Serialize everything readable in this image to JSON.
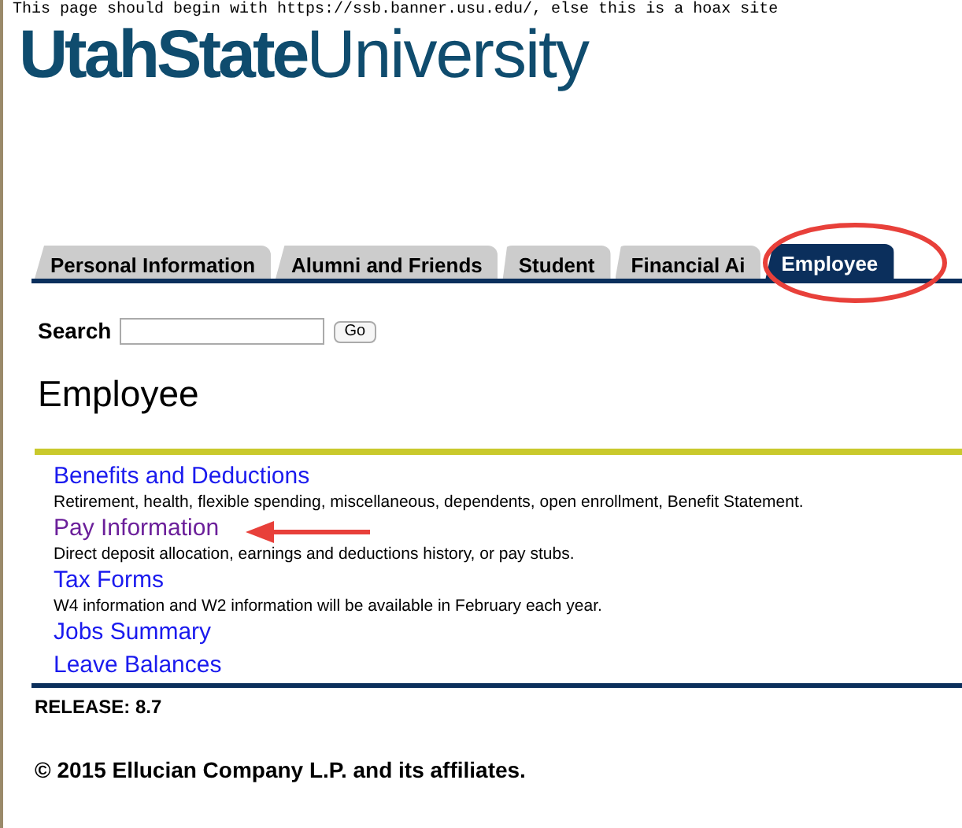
{
  "notice": "This page should begin with https://ssb.banner.usu.edu/, else this is a hoax site",
  "logo": {
    "bold": "UtahState",
    "regular": "University"
  },
  "tabs": [
    {
      "label": "Personal Information",
      "selected": false
    },
    {
      "label": "Alumni and Friends",
      "selected": false
    },
    {
      "label": "Student",
      "selected": false
    },
    {
      "label": "Financial Ai",
      "selected": false
    },
    {
      "label": "Employee",
      "selected": true
    }
  ],
  "search": {
    "label": "Search",
    "button": "Go"
  },
  "heading": "Employee",
  "menu": [
    {
      "title": "Benefits and Deductions",
      "visited": false,
      "description": "Retirement, health, flexible spending, miscellaneous, dependents, open enrollment, Benefit Statement."
    },
    {
      "title": "Pay Information",
      "visited": true,
      "description": "Direct deposit allocation, earnings and deductions history, or pay stubs."
    },
    {
      "title": "Tax Forms",
      "visited": false,
      "description": "W4 information and W2 information will be available in February each year."
    },
    {
      "title": "Jobs Summary",
      "visited": false
    },
    {
      "title": "Leave Balances",
      "visited": false
    }
  ],
  "release": "RELEASE: 8.7",
  "copyright": "© 2015 Ellucian Company L.P. and its affiliates."
}
